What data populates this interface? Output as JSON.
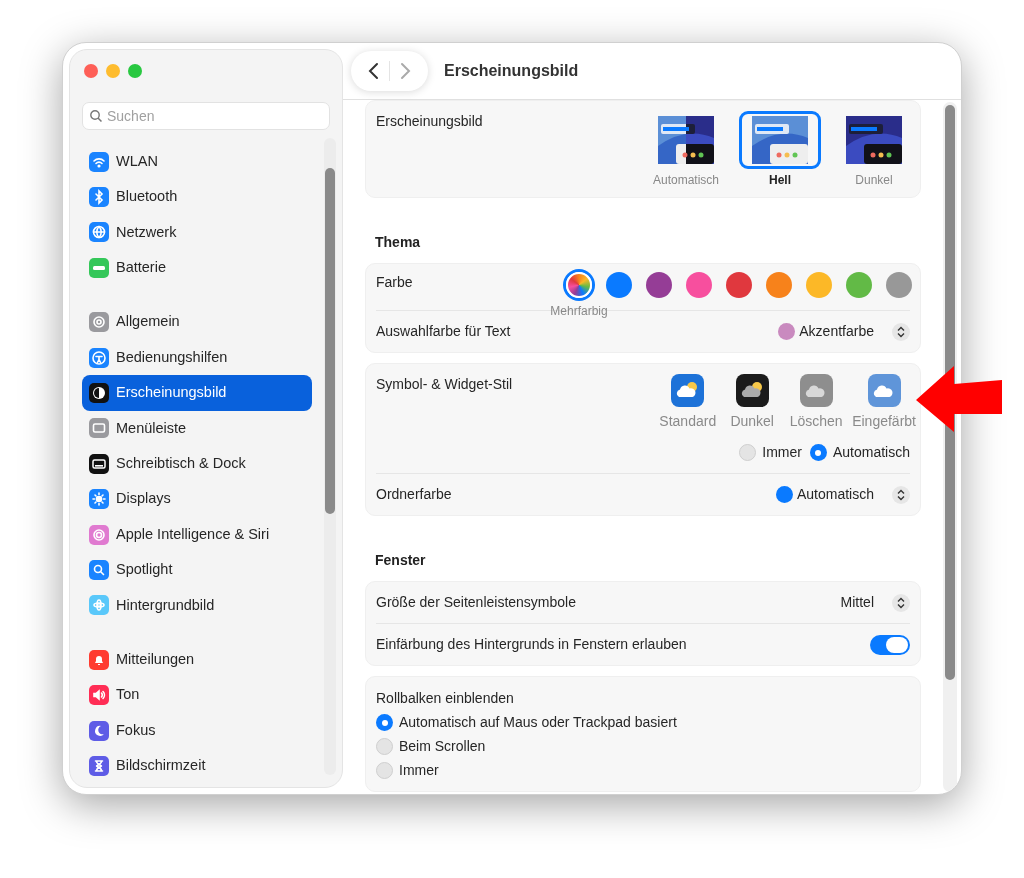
{
  "sidebar": {
    "search": {
      "placeholder": "Suchen"
    },
    "groups": [
      [
        {
          "label": "WLAN",
          "color": "#1a84ff",
          "selected": false
        },
        {
          "label": "Bluetooth",
          "color": "#1a84ff",
          "selected": false
        },
        {
          "label": "Netzwerk",
          "color": "#1a84ff",
          "selected": false
        },
        {
          "label": "Batterie",
          "color": "#34c759",
          "selected": false
        }
      ],
      [
        {
          "label": "Allgemein",
          "color": "#9a9a9e",
          "selected": false
        },
        {
          "label": "Bedienungshilfen",
          "color": "#1a84ff",
          "selected": false
        },
        {
          "label": "Erscheinungsbild",
          "color": "#111111",
          "selected": true
        },
        {
          "label": "Menüleiste",
          "color": "#9a9a9e",
          "selected": false
        },
        {
          "label": "Schreibtisch & Dock",
          "color": "#111111",
          "selected": false
        },
        {
          "label": "Displays",
          "color": "#1a84ff",
          "selected": false
        },
        {
          "label": "Apple Intelligence & Siri",
          "color": "#e07ad0",
          "selected": false
        },
        {
          "label": "Spotlight",
          "color": "#1a84ff",
          "selected": false
        },
        {
          "label": "Hintergrundbild",
          "color": "#5ac8fa",
          "selected": false
        }
      ],
      [
        {
          "label": "Mitteilungen",
          "color": "#ff3b30",
          "selected": false
        },
        {
          "label": "Ton",
          "color": "#ff2d55",
          "selected": false
        },
        {
          "label": "Fokus",
          "color": "#5e5ce6",
          "selected": false
        },
        {
          "label": "Bildschirmzeit",
          "color": "#5e5ce6",
          "selected": false
        }
      ]
    ]
  },
  "header": {
    "title": "Erscheinungsbild"
  },
  "sections": [
    {
      "groups": [
        [
          {
            "kind": "appearance",
            "label": "Erscheinungsbild",
            "options": [
              {
                "kind": "auto",
                "label": "Automatisch",
                "selected": false
              },
              {
                "kind": "light",
                "label": "Hell",
                "selected": true
              },
              {
                "kind": "dark",
                "label": "Dunkel",
                "selected": false
              }
            ]
          }
        ]
      ]
    },
    {
      "heading": "Thema",
      "groups": [
        [
          {
            "kind": "accent",
            "label": "Farbe",
            "swatches": [
              {
                "kind": "multicolor",
                "label": "Mehrfarbig",
                "selected": true
              },
              {
                "kind": "solid",
                "color": "#0a7aff",
                "selected": false
              },
              {
                "kind": "solid",
                "color": "#953d96",
                "selected": false
              },
              {
                "kind": "solid",
                "color": "#f74f9e",
                "selected": false
              },
              {
                "kind": "solid",
                "color": "#e0383e",
                "selected": false
              },
              {
                "kind": "solid",
                "color": "#f7821b",
                "selected": false
              },
              {
                "kind": "solid",
                "color": "#fcb827",
                "selected": false
              },
              {
                "kind": "solid",
                "color": "#62ba46",
                "selected": false
              },
              {
                "kind": "solid",
                "color": "#989898",
                "selected": false
              }
            ]
          },
          {
            "kind": "popup",
            "label": "Auswahlfarbe für Text",
            "value": "Akzentfarbe",
            "color": "#c98abf"
          }
        ],
        [
          {
            "kind": "icon_style",
            "label": "Symbol- & Widget-Stil",
            "options": [
              {
                "kind": "standard",
                "label": "Standard"
              },
              {
                "kind": "dark",
                "label": "Dunkel"
              },
              {
                "kind": "clear",
                "label": "Löschen"
              },
              {
                "kind": "tinted",
                "label": "Eingefärbt"
              }
            ],
            "radios": [
              {
                "label": "Immer",
                "selected": false
              },
              {
                "label": "Automatisch",
                "selected": true
              }
            ]
          },
          {
            "kind": "popup",
            "label": "Ordnerfarbe",
            "value": "Automatisch",
            "color": "#0a7aff"
          }
        ]
      ]
    },
    {
      "heading": "Fenster",
      "groups": [
        [
          {
            "kind": "popup",
            "label": "Größe der Seitenleistensymbole",
            "value": "Mittel"
          },
          {
            "kind": "toggle",
            "label": "Einfärbung des Hintergrunds in Fenstern erlauben",
            "on": true
          }
        ],
        [
          {
            "kind": "radio_list",
            "label": "Rollbalken einblenden",
            "options": [
              {
                "label": "Automatisch auf Maus oder Trackpad basiert",
                "selected": true
              },
              {
                "label": "Beim Scrollen",
                "selected": false
              },
              {
                "label": "Immer",
                "selected": false
              }
            ]
          }
        ]
      ]
    }
  ]
}
